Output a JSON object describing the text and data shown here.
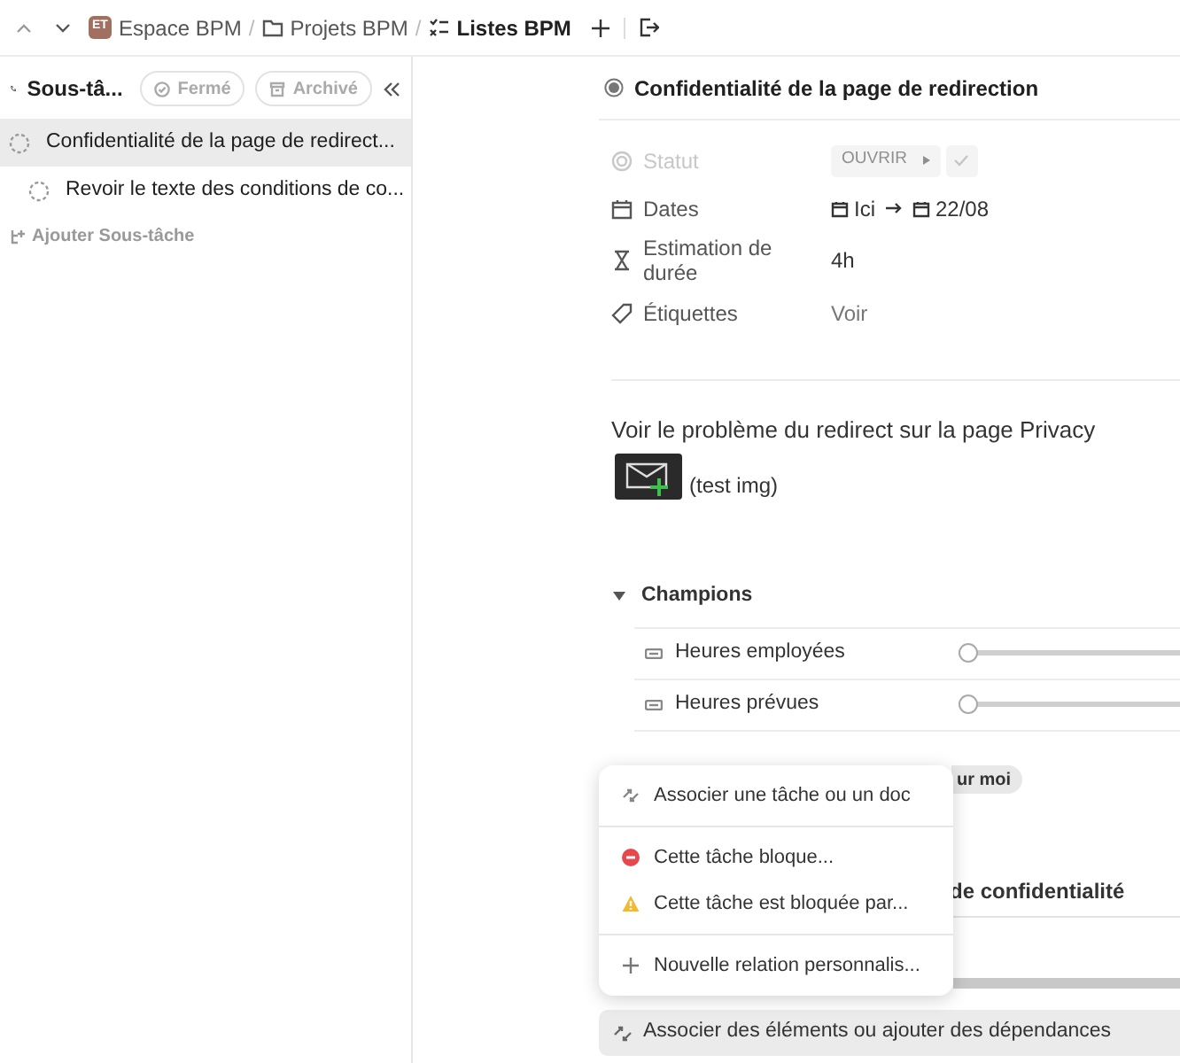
{
  "breadcrumb": [
    {
      "label": "Espace BPM",
      "kind": "space",
      "badge": "ET"
    },
    {
      "label": "Projets BPM",
      "kind": "folder",
      "separator": "/"
    },
    {
      "label": "Listes BPM",
      "kind": "list",
      "separator": "/"
    }
  ],
  "sidebar": {
    "title": "Sous-tâ...",
    "filters": [
      {
        "label": "Fermé",
        "kind": "closed"
      },
      {
        "label": "Archivé",
        "kind": "archive"
      }
    ],
    "items": [
      {
        "label": "Confidentialité de la page de redirect...",
        "selected": true,
        "children": [
          {
            "label": "Revoir le texte des conditions de co...",
            "selected": false
          }
        ]
      }
    ],
    "add_label": "Ajouter Sous-tâche"
  },
  "task": {
    "title": "Confidentialité de la page de redirection",
    "fields": [
      {
        "label": "Statut",
        "kind": "status",
        "value": "OUVRIR",
        "disabled": true
      },
      {
        "label": "Dates",
        "kind": "dates",
        "start": "Ici",
        "end": "22/08"
      },
      {
        "label": "Estimation de durée",
        "kind": "text",
        "value": "4h"
      },
      {
        "label": "Étiquettes",
        "kind": "tags",
        "value": "Voir"
      }
    ],
    "description": "Voir le problème du redirect sur la page Privacy",
    "image_caption": "(test img)",
    "section": {
      "title": "Champions",
      "expanded": true,
      "rows": [
        {
          "label": "Heures employées",
          "level": 0
        },
        {
          "label": "Heures prévues",
          "level": 0
        }
      ]
    },
    "hidden_chip": "ur moi",
    "hidden_text": "de confidentialité",
    "relations_button": "Associer des éléments ou ajouter des dépendances"
  },
  "menu": {
    "items": [
      {
        "label": "Associer une tâche ou un doc",
        "kind": "link"
      },
      {
        "label": "Cette tâche bloque...",
        "kind": "blocking"
      },
      {
        "label": "Cette tâche est bloquée par...",
        "kind": "waiting"
      },
      {
        "label": "Nouvelle relation personnalis...",
        "kind": "new"
      }
    ]
  }
}
